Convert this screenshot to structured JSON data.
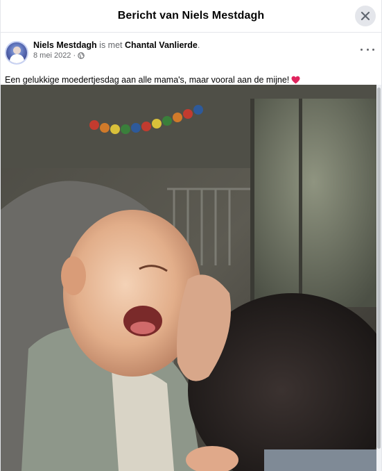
{
  "dialog": {
    "title": "Bericht van Niels Mestdagh"
  },
  "post": {
    "author": "Niels Mestdagh",
    "with_text": " is met ",
    "tagged": "Chantal Vanlierde",
    "tagged_suffix": ".",
    "date": "8 mei 2022",
    "date_separator": "·",
    "privacy_icon": "globe-icon",
    "text": "Een gelukkige moedertjesdag aan alle mama's, maar vooral aan de mijne!",
    "text_emoji": "red-heart-icon",
    "photo_alt": "Photo of a laughing baby being kissed by his mother"
  },
  "colors": {
    "heart": "#e0245e",
    "secondary_text": "#65676b",
    "close_button_bg": "#e4e6eb"
  }
}
